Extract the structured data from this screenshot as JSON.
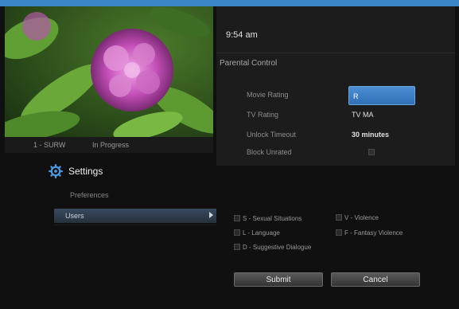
{
  "colors": {
    "accent": "#3a86c7",
    "dropdown": "#3f80c6",
    "panel": "#1c1c1c",
    "background": "#101010"
  },
  "now_playing": {
    "channel": "1 - SURW",
    "status": "In Progress"
  },
  "clock": {
    "time": "9:54 am"
  },
  "parental_control": {
    "title": "Parental Control",
    "movie_rating_label": "Movie Rating",
    "movie_rating_value": "R",
    "tv_rating_label": "TV Rating",
    "tv_rating_value": "TV MA",
    "unlock_timeout_label": "Unlock Timeout",
    "unlock_timeout_value": "30 minutes",
    "block_unrated_label": "Block Unrated",
    "block_unrated_checked": false
  },
  "settings": {
    "title": "Settings",
    "preferences_label": "Preferences",
    "users_label": "Users"
  },
  "content_categories": [
    {
      "label": "S - Sexual Situations",
      "checked": false
    },
    {
      "label": "V - Violence",
      "checked": false
    },
    {
      "label": "L - Language",
      "checked": false
    },
    {
      "label": "F - Fantasy Violence",
      "checked": false
    },
    {
      "label": "D - Suggestive Dialogue",
      "checked": false
    }
  ],
  "buttons": {
    "submit_label": "Submit",
    "cancel_label": "Cancel"
  },
  "icons": {
    "settings": "gear-icon",
    "users_arrow": "chevron-right-icon"
  }
}
